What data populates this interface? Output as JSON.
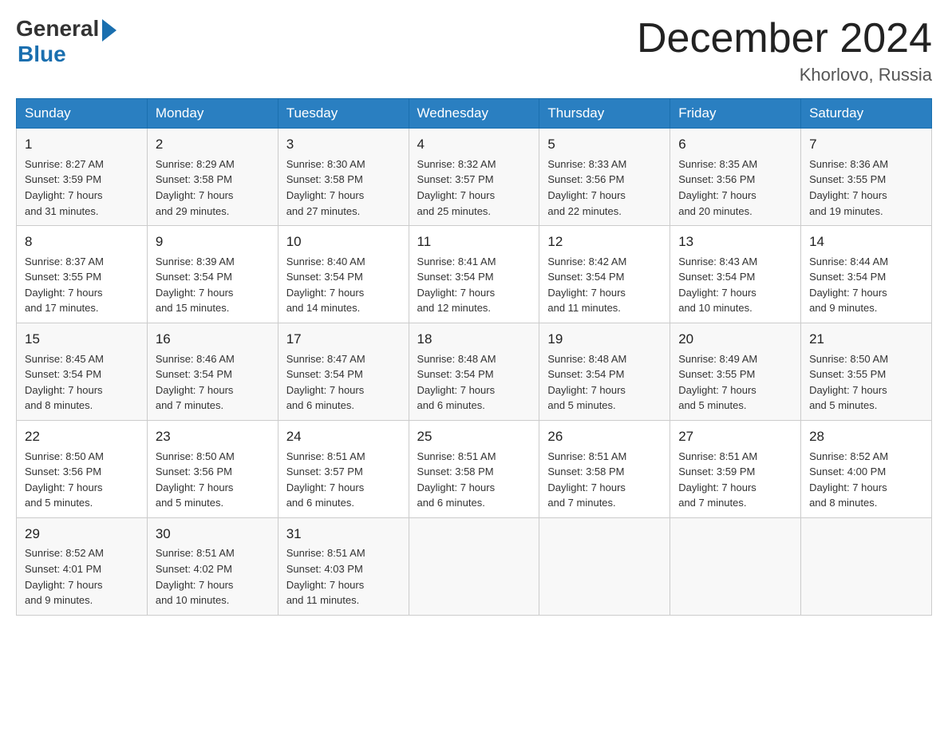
{
  "header": {
    "logo_general": "General",
    "logo_blue": "Blue",
    "title": "December 2024",
    "location": "Khorlovo, Russia"
  },
  "days_of_week": [
    "Sunday",
    "Monday",
    "Tuesday",
    "Wednesday",
    "Thursday",
    "Friday",
    "Saturday"
  ],
  "weeks": [
    [
      {
        "day": "1",
        "sunrise": "8:27 AM",
        "sunset": "3:59 PM",
        "daylight": "7 hours and 31 minutes."
      },
      {
        "day": "2",
        "sunrise": "8:29 AM",
        "sunset": "3:58 PM",
        "daylight": "7 hours and 29 minutes."
      },
      {
        "day": "3",
        "sunrise": "8:30 AM",
        "sunset": "3:58 PM",
        "daylight": "7 hours and 27 minutes."
      },
      {
        "day": "4",
        "sunrise": "8:32 AM",
        "sunset": "3:57 PM",
        "daylight": "7 hours and 25 minutes."
      },
      {
        "day": "5",
        "sunrise": "8:33 AM",
        "sunset": "3:56 PM",
        "daylight": "7 hours and 22 minutes."
      },
      {
        "day": "6",
        "sunrise": "8:35 AM",
        "sunset": "3:56 PM",
        "daylight": "7 hours and 20 minutes."
      },
      {
        "day": "7",
        "sunrise": "8:36 AM",
        "sunset": "3:55 PM",
        "daylight": "7 hours and 19 minutes."
      }
    ],
    [
      {
        "day": "8",
        "sunrise": "8:37 AM",
        "sunset": "3:55 PM",
        "daylight": "7 hours and 17 minutes."
      },
      {
        "day": "9",
        "sunrise": "8:39 AM",
        "sunset": "3:54 PM",
        "daylight": "7 hours and 15 minutes."
      },
      {
        "day": "10",
        "sunrise": "8:40 AM",
        "sunset": "3:54 PM",
        "daylight": "7 hours and 14 minutes."
      },
      {
        "day": "11",
        "sunrise": "8:41 AM",
        "sunset": "3:54 PM",
        "daylight": "7 hours and 12 minutes."
      },
      {
        "day": "12",
        "sunrise": "8:42 AM",
        "sunset": "3:54 PM",
        "daylight": "7 hours and 11 minutes."
      },
      {
        "day": "13",
        "sunrise": "8:43 AM",
        "sunset": "3:54 PM",
        "daylight": "7 hours and 10 minutes."
      },
      {
        "day": "14",
        "sunrise": "8:44 AM",
        "sunset": "3:54 PM",
        "daylight": "7 hours and 9 minutes."
      }
    ],
    [
      {
        "day": "15",
        "sunrise": "8:45 AM",
        "sunset": "3:54 PM",
        "daylight": "7 hours and 8 minutes."
      },
      {
        "day": "16",
        "sunrise": "8:46 AM",
        "sunset": "3:54 PM",
        "daylight": "7 hours and 7 minutes."
      },
      {
        "day": "17",
        "sunrise": "8:47 AM",
        "sunset": "3:54 PM",
        "daylight": "7 hours and 6 minutes."
      },
      {
        "day": "18",
        "sunrise": "8:48 AM",
        "sunset": "3:54 PM",
        "daylight": "7 hours and 6 minutes."
      },
      {
        "day": "19",
        "sunrise": "8:48 AM",
        "sunset": "3:54 PM",
        "daylight": "7 hours and 5 minutes."
      },
      {
        "day": "20",
        "sunrise": "8:49 AM",
        "sunset": "3:55 PM",
        "daylight": "7 hours and 5 minutes."
      },
      {
        "day": "21",
        "sunrise": "8:50 AM",
        "sunset": "3:55 PM",
        "daylight": "7 hours and 5 minutes."
      }
    ],
    [
      {
        "day": "22",
        "sunrise": "8:50 AM",
        "sunset": "3:56 PM",
        "daylight": "7 hours and 5 minutes."
      },
      {
        "day": "23",
        "sunrise": "8:50 AM",
        "sunset": "3:56 PM",
        "daylight": "7 hours and 5 minutes."
      },
      {
        "day": "24",
        "sunrise": "8:51 AM",
        "sunset": "3:57 PM",
        "daylight": "7 hours and 6 minutes."
      },
      {
        "day": "25",
        "sunrise": "8:51 AM",
        "sunset": "3:58 PM",
        "daylight": "7 hours and 6 minutes."
      },
      {
        "day": "26",
        "sunrise": "8:51 AM",
        "sunset": "3:58 PM",
        "daylight": "7 hours and 7 minutes."
      },
      {
        "day": "27",
        "sunrise": "8:51 AM",
        "sunset": "3:59 PM",
        "daylight": "7 hours and 7 minutes."
      },
      {
        "day": "28",
        "sunrise": "8:52 AM",
        "sunset": "4:00 PM",
        "daylight": "7 hours and 8 minutes."
      }
    ],
    [
      {
        "day": "29",
        "sunrise": "8:52 AM",
        "sunset": "4:01 PM",
        "daylight": "7 hours and 9 minutes."
      },
      {
        "day": "30",
        "sunrise": "8:51 AM",
        "sunset": "4:02 PM",
        "daylight": "7 hours and 10 minutes."
      },
      {
        "day": "31",
        "sunrise": "8:51 AM",
        "sunset": "4:03 PM",
        "daylight": "7 hours and 11 minutes."
      },
      null,
      null,
      null,
      null
    ]
  ],
  "labels": {
    "sunrise": "Sunrise:",
    "sunset": "Sunset:",
    "daylight": "Daylight:"
  }
}
